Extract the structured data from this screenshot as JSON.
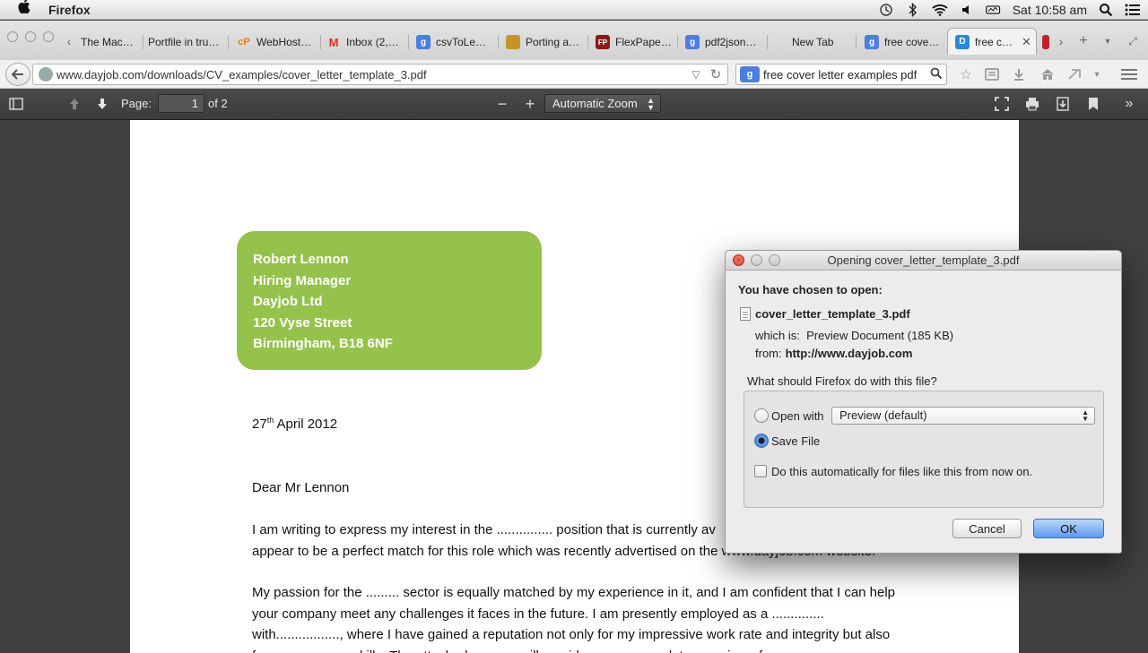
{
  "menubar": {
    "apple": "",
    "app_name": "Firefox",
    "clock": "Sat 10:58 am"
  },
  "tabs": [
    {
      "label": "The Mac…",
      "favicon": ""
    },
    {
      "label": "Portfile in tru…",
      "favicon": ""
    },
    {
      "label": "WebHost…",
      "favicon": "cP"
    },
    {
      "label": "Inbox (2,…",
      "favicon": "M"
    },
    {
      "label": "csvToLe…",
      "favicon": "g"
    },
    {
      "label": "Porting a…",
      "favicon": ""
    },
    {
      "label": "FlexPape…",
      "favicon": "FP"
    },
    {
      "label": "pdf2json…",
      "favicon": "g"
    },
    {
      "label": "New Tab",
      "favicon": ""
    },
    {
      "label": "free cove…",
      "favicon": "g"
    },
    {
      "label": "free c…",
      "favicon": "D",
      "active": true
    },
    {
      "label": "",
      "favicon": ""
    }
  ],
  "nav": {
    "url": "www.dayjob.com/downloads/CV_examples/cover_letter_template_3.pdf",
    "search_engine": "g",
    "search_query": "free cover letter examples pdf"
  },
  "pdf_toolbar": {
    "page_label": "Page:",
    "page_value": "1",
    "page_total": "of 2",
    "zoom": "Automatic Zoom"
  },
  "document": {
    "address": [
      "Robert Lennon",
      "Hiring Manager",
      "Dayjob Ltd",
      "120 Vyse Street",
      "Birmingham, B18 6NF"
    ],
    "date_day": "27",
    "date_suffix": "th",
    "date_rest": " April 2012",
    "salutation": "Dear Mr Lennon",
    "para1_line1": "I am writing to express my interest in the ............... position that is currently av",
    "para1_line2": "appear to be a perfect match for this role which was recently advertised on the www.dayjob.com website.",
    "para2_lines": [
      "My passion for the ......... sector is equally matched by my experience in it, and I am confident that I can help",
      "your company meet any challenges it faces in the future. I am presently employed as a ..............",
      "with................., where I have gained a reputation not only for my impressive work rate and integrity but also",
      "for my ............... skills. The attached resume will provide a more complete overview of my"
    ]
  },
  "dialog": {
    "title": "Opening cover_letter_template_3.pdf",
    "chosen_label": "You have chosen to open:",
    "filename": "cover_letter_template_3.pdf",
    "which_is_label": "which is:",
    "which_is_value": "Preview Document (185 KB)",
    "from_label": "from:",
    "from_value": "http://www.dayjob.com",
    "question": "What should Firefox do with this file?",
    "open_with_label": "Open with",
    "open_with_app": "Preview (default)",
    "save_file_label": "Save File",
    "auto_label": "Do this automatically for files like this from now on.",
    "cancel_label": "Cancel",
    "ok_label": "OK",
    "selected_option": "save_file"
  }
}
